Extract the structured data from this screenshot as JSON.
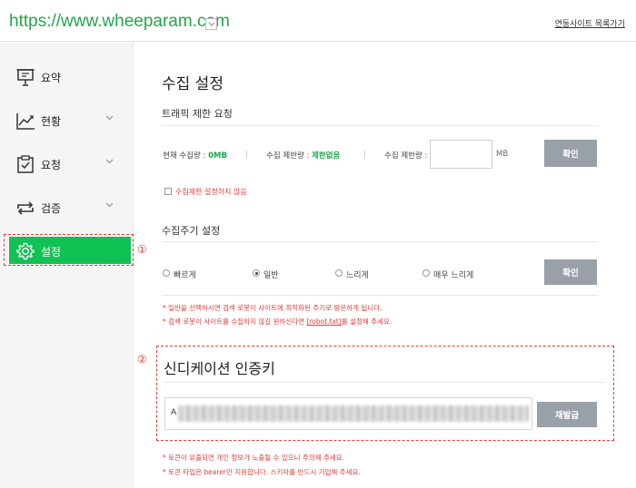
{
  "header": {
    "site_url": "https://www.wheeparam.com",
    "site_list_link": "연동사이트 목록가기"
  },
  "sidebar": {
    "items": [
      {
        "label": "요약",
        "icon": "presentation-board-icon"
      },
      {
        "label": "현황",
        "icon": "line-chart-icon"
      },
      {
        "label": "요청",
        "icon": "clipboard-check-icon"
      },
      {
        "label": "검증",
        "icon": "refresh-arrows-icon"
      },
      {
        "label": "설정",
        "icon": "gear-icon"
      }
    ],
    "annotation": "①"
  },
  "main": {
    "title": "수집 설정",
    "traffic": {
      "title": "트래픽 제한 요청",
      "current_label": "현재 수집량 : ",
      "current_value": "0MB",
      "limit_label": "수집 제한량 : ",
      "limit_value": "제한없음",
      "input_label": "수집 제한량 :",
      "input_value": "",
      "unit": "MB",
      "confirm": "확인",
      "no_limit_checkbox": "수집제한 설정하지 않음"
    },
    "cycle": {
      "title": "수집주기 설정",
      "options": [
        "빠르게",
        "일반",
        "느리게",
        "매우 느리게"
      ],
      "selected": "일반",
      "confirm": "확인",
      "note1": "* 일반을 선택하시면 검색 로봇이 사이트에 최적화된 주기로 방문하게 됩니다.",
      "note2_a": "* 검색 로봇이 사이트를 수집하지 않길 원하신다면 ",
      "note2_link": "[robot.txt]",
      "note2_b": "를 설정해 주세요."
    },
    "cert": {
      "annotation": "②",
      "title": "신디케이션 인증키",
      "token_value": "A",
      "reissue": "재발급",
      "note1": "* 토큰이 유출되면 개인 정보가 노출될 수 있으니 주의해 주세요.",
      "note2": "* 토큰 타입은 bearer만 지원합니다. 스키마를 반드시 기입해 주세요."
    }
  },
  "colors": {
    "brand_green": "#10c253",
    "url_green": "#23a64a",
    "warning_red": "#e23a3a",
    "button_gray": "#9aa0a8"
  }
}
